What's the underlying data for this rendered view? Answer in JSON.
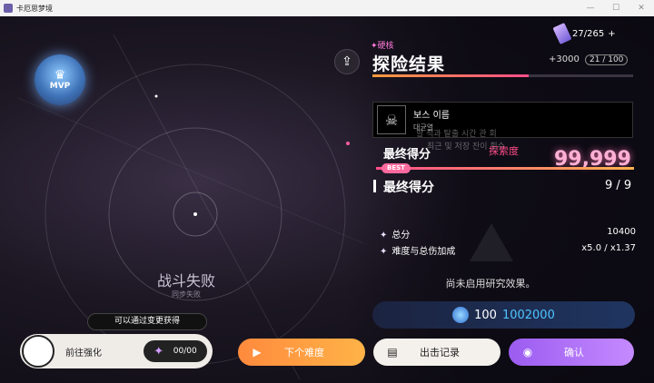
{
  "window": {
    "title": "卡厄思梦境"
  },
  "hud": {
    "counter": "27/265",
    "counter_plus": "+"
  },
  "mvp": {
    "label": "MVP"
  },
  "battle": {
    "status": "战斗失败",
    "substatus": "同步失败"
  },
  "result": {
    "difficulty_tag": "硬核",
    "title": "探险结果",
    "score_bonus": "+3000",
    "score_level": "21 / 100"
  },
  "boss_tooltip": {
    "name": "보스 이름",
    "subtitle": "대균열"
  },
  "ghost_text": {
    "line1": "할 적과 탈출 시간 관 회",
    "line2": "최근 및 저장 잔이 횟수"
  },
  "score": {
    "explore_label": "探索度",
    "final_label_a": "最终得分",
    "big_value": "99,999",
    "best_badge": "BEST",
    "final_label_b": "最终得分",
    "ratio": "9 / 9"
  },
  "summary": {
    "total_label": "总分",
    "total_value": "10400",
    "mult_label": "难度与总伤加成",
    "mult_value": "x5.0 / x1.37"
  },
  "research_note": "尚未启用研究效果。",
  "reward": {
    "base": "100",
    "bonus": "1002000"
  },
  "enhance": {
    "hint": "可以通过变更获得",
    "label": "前往强化",
    "count": "00/00"
  },
  "buttons": {
    "next": "下个难度",
    "record": "出击记录",
    "confirm": "确认"
  }
}
